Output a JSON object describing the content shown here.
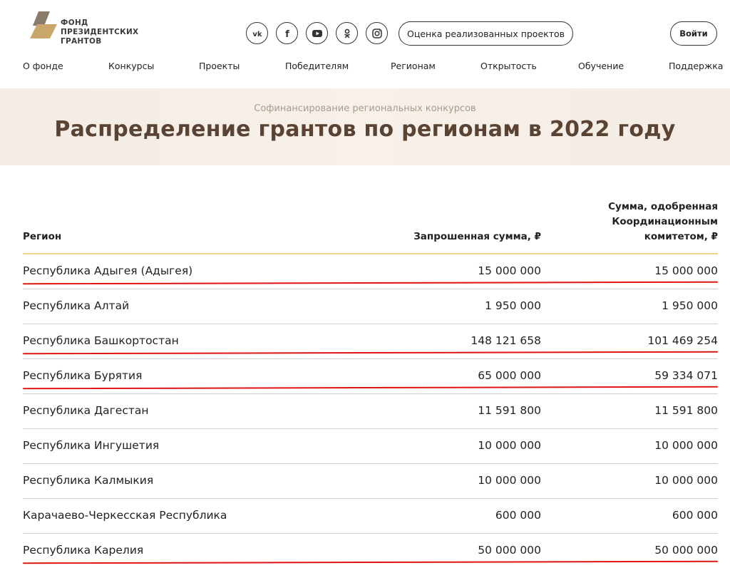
{
  "logo": {
    "text": "ФОНД\nПРЕЗИДЕНТСКИХ\nГРАНТОВ"
  },
  "header": {
    "socials": [
      "vk-icon",
      "facebook-icon",
      "youtube-icon",
      "odnoklassniki-icon",
      "instagram-icon"
    ],
    "eval_button": "Оценка реализованных проектов",
    "login_button": "Войти"
  },
  "nav": {
    "items": [
      "О фонде",
      "Конкурсы",
      "Проекты",
      "Победителям",
      "Регионам",
      "Открытость",
      "Обучение",
      "Поддержка"
    ]
  },
  "banner": {
    "subtitle": "Софинансирование региональных конкурсов",
    "title": "Распределение грантов по регионам в 2022 году"
  },
  "table": {
    "headers": {
      "region": "Регион",
      "requested": "Запрошенная сумма, ₽",
      "approved": "Сумма, одобренная\nКоординационным\nкомитетом, ₽"
    },
    "rows": [
      {
        "region": "Республика Адыгея (Адыгея)",
        "requested": "15 000 000",
        "approved": "15 000 000",
        "underlined": true
      },
      {
        "region": "Республика Алтай",
        "requested": "1 950 000",
        "approved": "1 950 000",
        "underlined": false
      },
      {
        "region": "Республика Башкортостан",
        "requested": "148 121 658",
        "approved": "101 469 254",
        "underlined": true
      },
      {
        "region": "Республика Бурятия",
        "requested": "65 000 000",
        "approved": "59 334 071",
        "underlined": true
      },
      {
        "region": "Республика Дагестан",
        "requested": "11 591 800",
        "approved": "11 591 800",
        "underlined": false
      },
      {
        "region": "Республика Ингушетия",
        "requested": "10 000 000",
        "approved": "10 000 000",
        "underlined": false
      },
      {
        "region": "Республика Калмыкия",
        "requested": "10 000 000",
        "approved": "10 000 000",
        "underlined": false
      },
      {
        "region": "Карачаево-Черкесская Республика",
        "requested": "600 000",
        "approved": "600 000",
        "underlined": false
      },
      {
        "region": "Республика Карелия",
        "requested": "50 000 000",
        "approved": "50 000 000",
        "underlined": true
      }
    ]
  },
  "colors": {
    "brand_gold": "#c9a66b",
    "title_brown": "#5a4333",
    "header_rule": "#f2d58c",
    "annotation_red": "#e11414"
  }
}
